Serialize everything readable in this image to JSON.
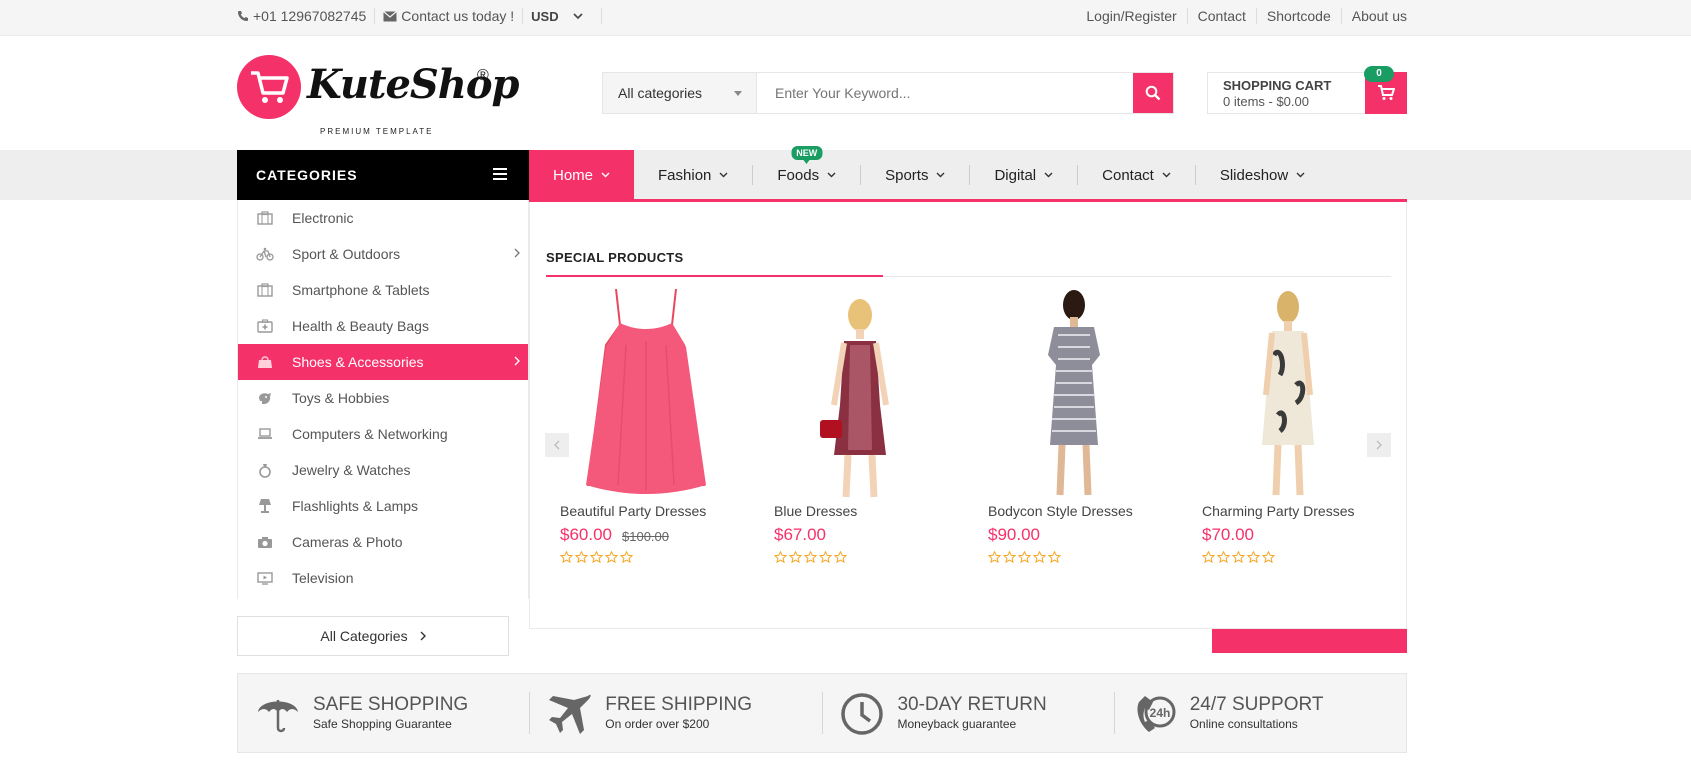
{
  "topbar": {
    "phone": "+01 12967082745",
    "contact": "Contact us today !",
    "currency": "USD",
    "links": [
      "Login/Register",
      "Contact",
      "Shortcode",
      "About us"
    ]
  },
  "header": {
    "logo_text": "KuteShop",
    "logo_reg": "®",
    "logo_sub": "PREMIUM TEMPLATE",
    "search": {
      "category": "All categories",
      "placeholder": "Enter Your Keyword..."
    },
    "cart": {
      "title": "SHOPPING CART",
      "summary": "0 items - $0.00",
      "count": "0"
    }
  },
  "nav": {
    "categories_label": "CATEGORIES",
    "items": [
      {
        "label": "Home",
        "active": true
      },
      {
        "label": "Fashion"
      },
      {
        "label": "Foods",
        "badge": "NEW"
      },
      {
        "label": "Sports"
      },
      {
        "label": "Digital"
      },
      {
        "label": "Contact"
      },
      {
        "label": "Slideshow"
      }
    ]
  },
  "sidebar": {
    "items": [
      {
        "label": "Electronic",
        "icon": "briefcase-icon"
      },
      {
        "label": "Sport & Outdoors",
        "icon": "bicycle-icon",
        "has_sub": true
      },
      {
        "label": "Smartphone & Tablets",
        "icon": "briefcase-icon"
      },
      {
        "label": "Health & Beauty Bags",
        "icon": "medical-kit-icon"
      },
      {
        "label": "Shoes & Accessories",
        "icon": "bag-icon",
        "active": true,
        "has_sub": true
      },
      {
        "label": "Toys & Hobbies",
        "icon": "toy-icon"
      },
      {
        "label": "Computers & Networking",
        "icon": "laptop-icon"
      },
      {
        "label": "Jewelry & Watches",
        "icon": "ring-icon"
      },
      {
        "label": "Flashlights & Lamps",
        "icon": "lamp-icon"
      },
      {
        "label": "Cameras & Photo",
        "icon": "camera-icon"
      },
      {
        "label": "Television",
        "icon": "tv-icon"
      }
    ],
    "all_label": "All Categories"
  },
  "special": {
    "title": "SPECIAL PRODUCTS",
    "products": [
      {
        "name": "Beautiful Party Dresses",
        "price": "$60.00",
        "old_price": "$100.00",
        "rating": 0
      },
      {
        "name": "Blue Dresses",
        "price": "$67.00",
        "rating": 0
      },
      {
        "name": "Bodycon Style Dresses",
        "price": "$90.00",
        "rating": 0
      },
      {
        "name": "Charming Party Dresses",
        "price": "$70.00",
        "rating": 0
      }
    ]
  },
  "services": [
    {
      "title": "SAFE SHOPPING",
      "sub": "Safe Shopping Guarantee",
      "icon": "umbrella-icon"
    },
    {
      "title": "FREE SHIPPING",
      "sub": "On order over $200",
      "icon": "airplane-icon"
    },
    {
      "title": "30-DAY RETURN",
      "sub": "Moneyback guarantee",
      "icon": "clock-icon"
    },
    {
      "title": "24/7 SUPPORT",
      "sub": "Online consultations",
      "icon": "phone-24h-icon"
    }
  ],
  "colors": {
    "accent": "#f5316a",
    "badge": "#1a9d63",
    "star": "#f5a623"
  }
}
